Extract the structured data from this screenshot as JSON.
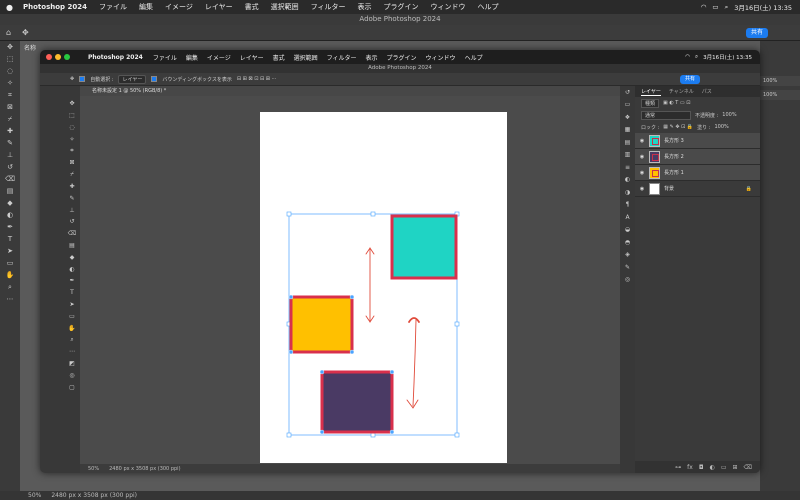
{
  "outer": {
    "apple_icon": "apple-icon",
    "app_name": "Photoshop 2024",
    "menus": [
      "ファイル",
      "編集",
      "イメージ",
      "レイヤー",
      "書式",
      "選択範囲",
      "フィルター",
      "表示",
      "プラグイン",
      "ウィンドウ",
      "ヘルプ"
    ],
    "clock": "3月16日(土)  13:35",
    "window_title": "Adobe Photoshop 2024",
    "share_label": "共有",
    "zoom": "50%",
    "doc_size": "2480 px x 3508 px (300 ppi)",
    "doc_tab": "名称",
    "percent_labels": [
      "100%",
      "100%"
    ]
  },
  "inner": {
    "app_name": "Photoshop 2024",
    "menus": [
      "ファイル",
      "編集",
      "イメージ",
      "レイヤー",
      "書式",
      "選択範囲",
      "フィルター",
      "表示",
      "プラグイン",
      "ウィンドウ",
      "ヘルプ"
    ],
    "clock": "3月16日(土)  13:35",
    "window_title": "Adobe Photoshop 2024",
    "options": {
      "auto_select": "自動選択 :",
      "layer_select": "レイヤー",
      "bounding_box": "バウンディングボックスを表示"
    },
    "share_label": "共有",
    "doc_tab": "名称未設定 1 @ 50% (RGB/8) *",
    "zoom": "50%",
    "doc_size": "2480 px x 3508 px (300 ppi)",
    "panel_tabs": [
      "レイヤー",
      "チャンネル",
      "パス"
    ],
    "kind_select": "種類",
    "blend_mode": "通常",
    "opacity_label": "不透明度 :",
    "opacity_value": "100%",
    "lock_label": "ロック :",
    "fill_label": "塗り :",
    "fill_value": "100%",
    "layers": [
      {
        "name": "長方形 3",
        "color": "#1fd4c4"
      },
      {
        "name": "長方形 2",
        "color": "#4a3a64"
      },
      {
        "name": "長方形 1",
        "color": "#ffc000"
      },
      {
        "name": "背景",
        "color": "#ffffff"
      }
    ]
  },
  "colors": {
    "teal": "#1fd4c4",
    "yellow": "#ffc000",
    "purple": "#4a3a64",
    "border_red": "#d8304c",
    "selection_blue": "#4aa3ff",
    "arrow_red": "#e04a3a"
  }
}
